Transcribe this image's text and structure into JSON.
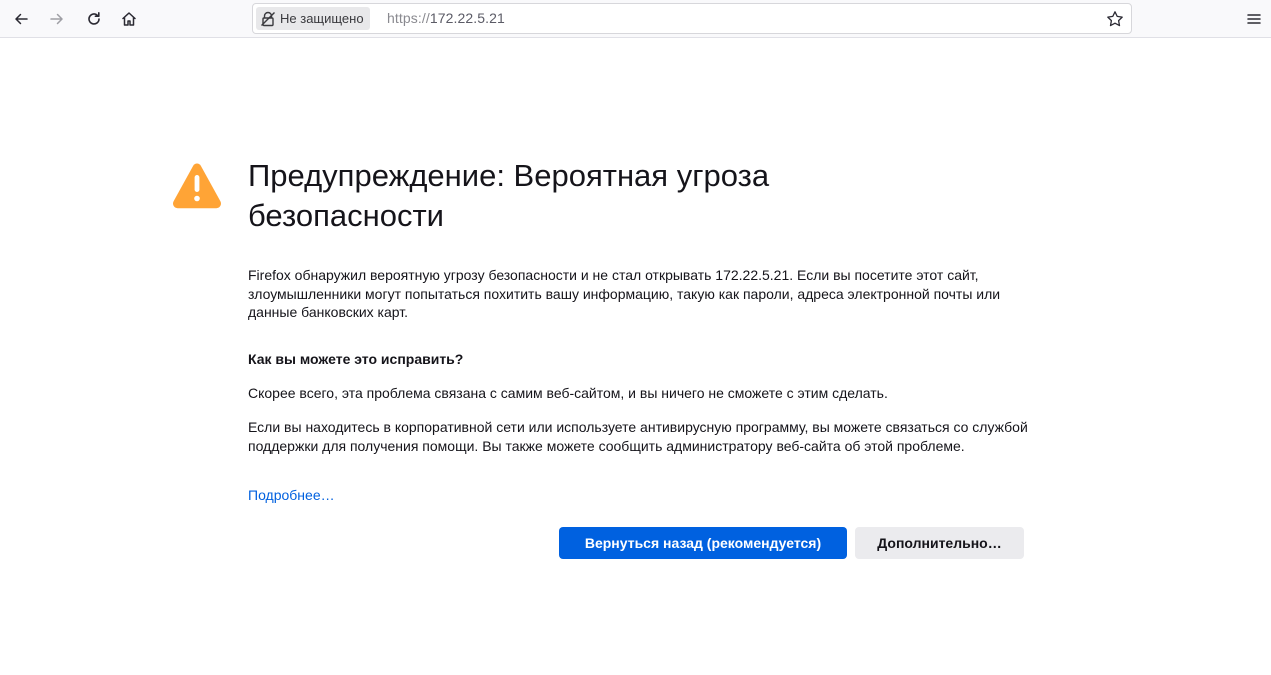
{
  "browser": {
    "not_secure_label": "Не защищено",
    "url_scheme": "https://",
    "url_host": "172.22.5.21",
    "icons": {
      "back": "back-arrow-icon",
      "forward": "forward-arrow-icon",
      "reload": "reload-icon",
      "home": "home-icon",
      "lock": "insecure-lock-icon",
      "bookmark": "star-icon",
      "menu": "hamburger-menu-icon"
    }
  },
  "error_page": {
    "title": "Предупреждение: Вероятная угроза безопасности",
    "intro": "Firefox обнаружил вероятную угрозу безопасности и не стал открывать 172.22.5.21. Если вы посетите этот сайт, злоумышленники могут попытаться похитить вашу информацию, такую как пароли, адреса электронной почты или данные банковских карт.",
    "fix_heading": "Как вы можете это исправить?",
    "fix_text_1": "Скорее всего, эта проблема связана с самим веб-сайтом, и вы ничего не сможете с этим сделать.",
    "fix_text_2": "Если вы находитесь в корпоративной сети или используете антивирусную программу, вы можете связаться со службой поддержки для получения помощи. Вы также можете сообщить администратору веб-сайта об этой проблеме.",
    "learn_more": "Подробнее…",
    "go_back_button": "Вернуться назад (рекомендуется)",
    "advanced_button": "Дополнительно…",
    "colors": {
      "warning_icon": "#ffa436",
      "primary_button": "#0061e0",
      "link": "#0060df"
    }
  }
}
